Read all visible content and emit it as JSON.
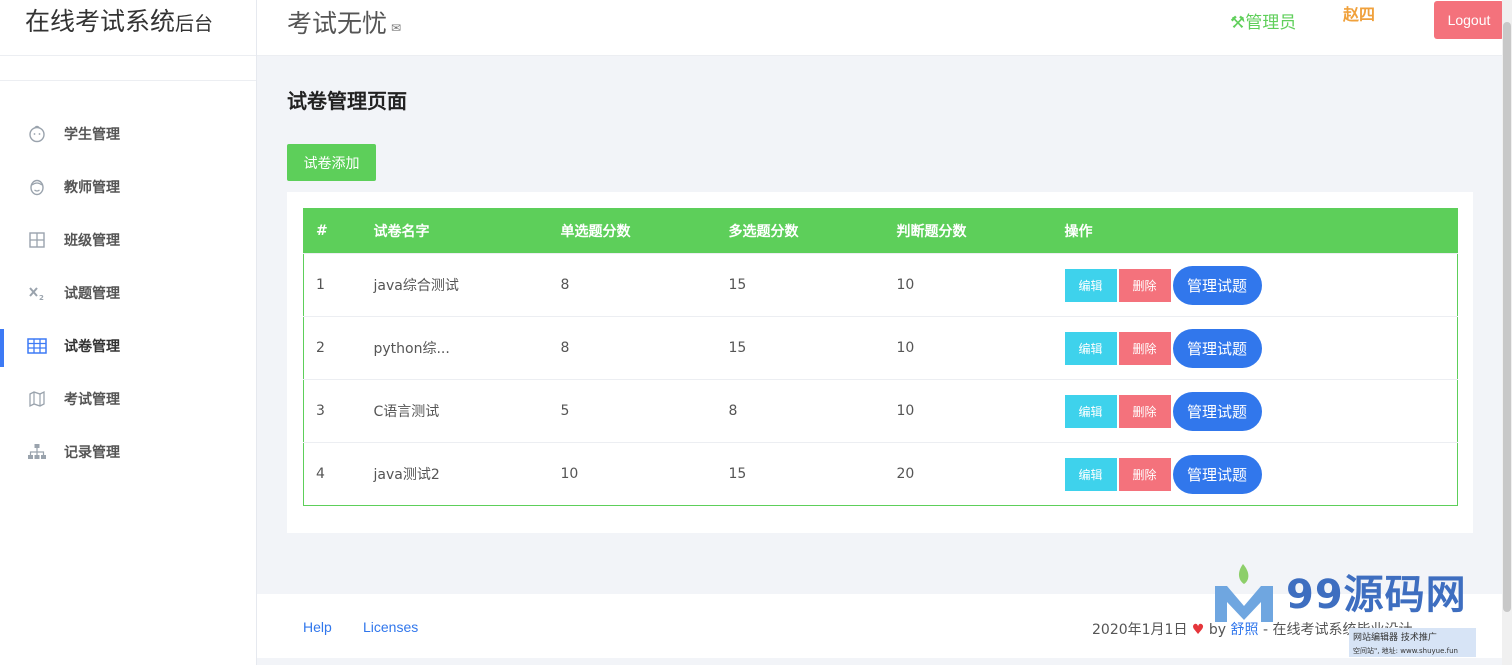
{
  "brand": {
    "main": "在线考试系统",
    "sub": "后台"
  },
  "header": {
    "title": "考试无忧",
    "role": "管理员",
    "username": "赵四",
    "logout_label": "Logout"
  },
  "sidebar": {
    "items": [
      {
        "label": "学生管理",
        "icon": "baby-face-icon"
      },
      {
        "label": "教师管理",
        "icon": "face-icon"
      },
      {
        "label": "班级管理",
        "icon": "grid-icon"
      },
      {
        "label": "试题管理",
        "icon": "subscript-icon"
      },
      {
        "label": "试卷管理",
        "icon": "table-icon",
        "active": true
      },
      {
        "label": "考试管理",
        "icon": "map-icon"
      },
      {
        "label": "记录管理",
        "icon": "sitemap-icon"
      }
    ]
  },
  "main": {
    "page_title": "试卷管理页面",
    "add_button": "试卷添加",
    "table": {
      "headers": [
        "#",
        "试卷名字",
        "单选题分数",
        "多选题分数",
        "判断题分数",
        "操作"
      ],
      "rows": [
        {
          "id": "1",
          "name": "java综合测试",
          "single": "8",
          "multi": "15",
          "judge": "10"
        },
        {
          "id": "2",
          "name": "python综...",
          "single": "8",
          "multi": "15",
          "judge": "10"
        },
        {
          "id": "3",
          "name": "C语言测试",
          "single": "5",
          "multi": "8",
          "judge": "10"
        },
        {
          "id": "4",
          "name": "java测试2",
          "single": "10",
          "multi": "15",
          "judge": "20"
        }
      ],
      "actions": {
        "edit": "编辑",
        "delete": "删除",
        "manage": "管理试题"
      }
    }
  },
  "footer": {
    "help": "Help",
    "licenses": "Licenses",
    "date": "2020年1月1日",
    "by": "by",
    "author": "舒照",
    "rest": "- 在线考试系统毕业设计"
  },
  "watermark": {
    "text": "99源码网",
    "banner_line1": "网站编辑器 技术推广",
    "banner_line2": "空间站\", 地址: www.shuyue.fun"
  },
  "colors": {
    "accent_green": "#5dcf5a",
    "primary_blue": "#3177ec",
    "danger": "#f4727c",
    "info": "#3ed2ec",
    "user_orange": "#f0a13c"
  }
}
